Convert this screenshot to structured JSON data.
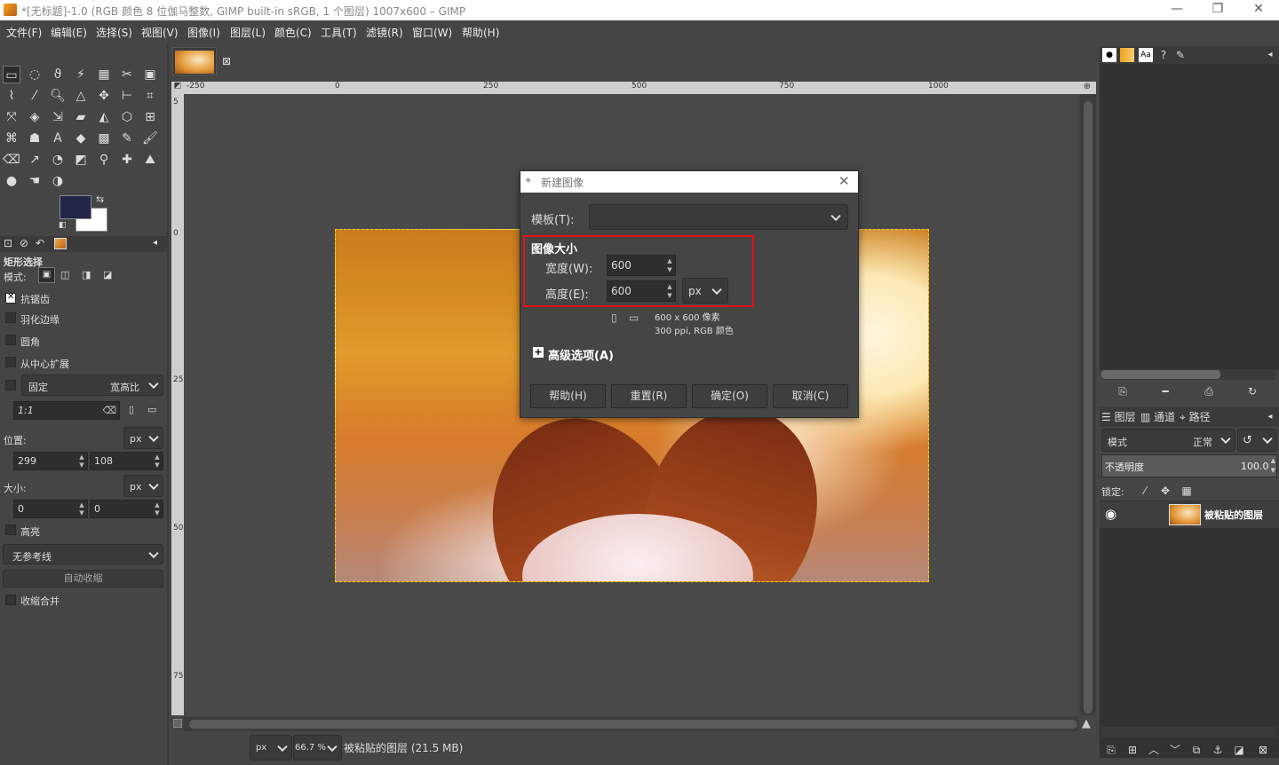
{
  "window": {
    "title": "*[无标题]-1.0 (RGB 颜色 8 位伽马整数, GIMP built-in sRGB, 1 个图层) 1007x600 – GIMP"
  },
  "menu": [
    "文件(F)",
    "编辑(E)",
    "选择(S)",
    "视图(V)",
    "图像(I)",
    "图层(L)",
    "颜色(C)",
    "工具(T)",
    "滤镜(R)",
    "窗口(W)",
    "帮助(H)"
  ],
  "tool_options": {
    "title": "矩形选择",
    "mode_label": "模式:",
    "antialias": "抗锯齿",
    "feather": "羽化边缘",
    "rounded": "圆角",
    "expand_center": "从中心扩展",
    "fixed": "固定",
    "fixed_kind": "宽高比",
    "ratio": "1:1",
    "position_label": "位置:",
    "position_unit": "px",
    "pos_x": "299",
    "pos_y": "108",
    "size_label": "大小:",
    "size_unit": "px",
    "size_w": "0",
    "size_h": "0",
    "highlight": "高亮",
    "guides": "无参考线",
    "auto_shrink": "自动收缩",
    "shrink_merged": "收缩合并"
  },
  "rulers": {
    "h_ticks": [
      "-250",
      "0",
      "250",
      "500",
      "750",
      "1000"
    ],
    "v_ticks": [
      "5",
      "0",
      "250",
      "500",
      "750"
    ]
  },
  "status": {
    "unit": "px",
    "zoom": "66.7 %",
    "layer_info": "被粘贴的图层 (21.5 MB)"
  },
  "dialog": {
    "title": "新建图像",
    "template_label": "模板(T):",
    "template_value": "",
    "section_title": "图像大小",
    "width_label": "宽度(W):",
    "width_value": "600",
    "height_label": "高度(E):",
    "height_value": "600",
    "unit": "px",
    "info_size": "600 x 600 像素",
    "info_res": "300 ppi, RGB 颜色",
    "advanced": "高级选项(A)",
    "buttons": {
      "help": "帮助(H)",
      "reset": "重置(R)",
      "ok": "确定(O)",
      "cancel": "取消(C)"
    }
  },
  "dock": {
    "tabs": [
      "图层",
      "通道",
      "路径"
    ],
    "mode_label": "模式",
    "mode_value": "正常",
    "opacity_label": "不透明度",
    "opacity_value": "100.0",
    "lock_label": "锁定:",
    "layer_name": "被粘贴的图层"
  },
  "colors": {
    "accent_red": "#e5111a",
    "foreground": "#222448",
    "background": "#ffffff",
    "selection": "#f5d000"
  }
}
